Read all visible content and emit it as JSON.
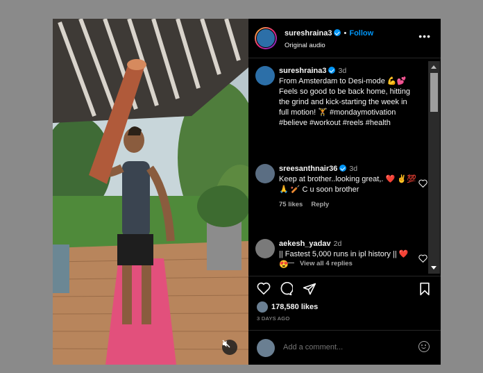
{
  "post": {
    "username": "sureshraina3",
    "follow_label": "Follow",
    "audio_label": "Original audio",
    "more_label": "•••",
    "caption_time": "3d",
    "caption_text": "From Amsterdam to Desi-mode 💪💕 Feels so good to be back home, hitting the grind and kick-starting the week in full motion! 🏋 #mondaymotivation #believe #workout #reels #health"
  },
  "comments": [
    {
      "username": "sreesanthnair36",
      "time": "3d",
      "text": "Keep at brother..looking great,. ❤️ ✌️💯🙏 🏏 C u soon brother",
      "likes": "75 likes",
      "reply_label": "Reply",
      "view_replies": "View all 4 replies"
    },
    {
      "username": "aekesh_yadav",
      "time": "2d",
      "text": "|| Fastest 5,000 runs in ipl history || ❤️ 😍"
    }
  ],
  "stats": {
    "likes": "178,580 likes",
    "date": "3 DAYS AGO"
  },
  "add_comment": {
    "placeholder": "Add a comment..."
  },
  "icons": [
    "verified-icon",
    "more-icon",
    "heart-icon",
    "comment-icon",
    "share-icon",
    "bookmark-icon",
    "mute-icon",
    "emoji-icon"
  ],
  "colors": {
    "accent": "#0095f6",
    "heart": "#ff3040",
    "background": "#000000"
  }
}
